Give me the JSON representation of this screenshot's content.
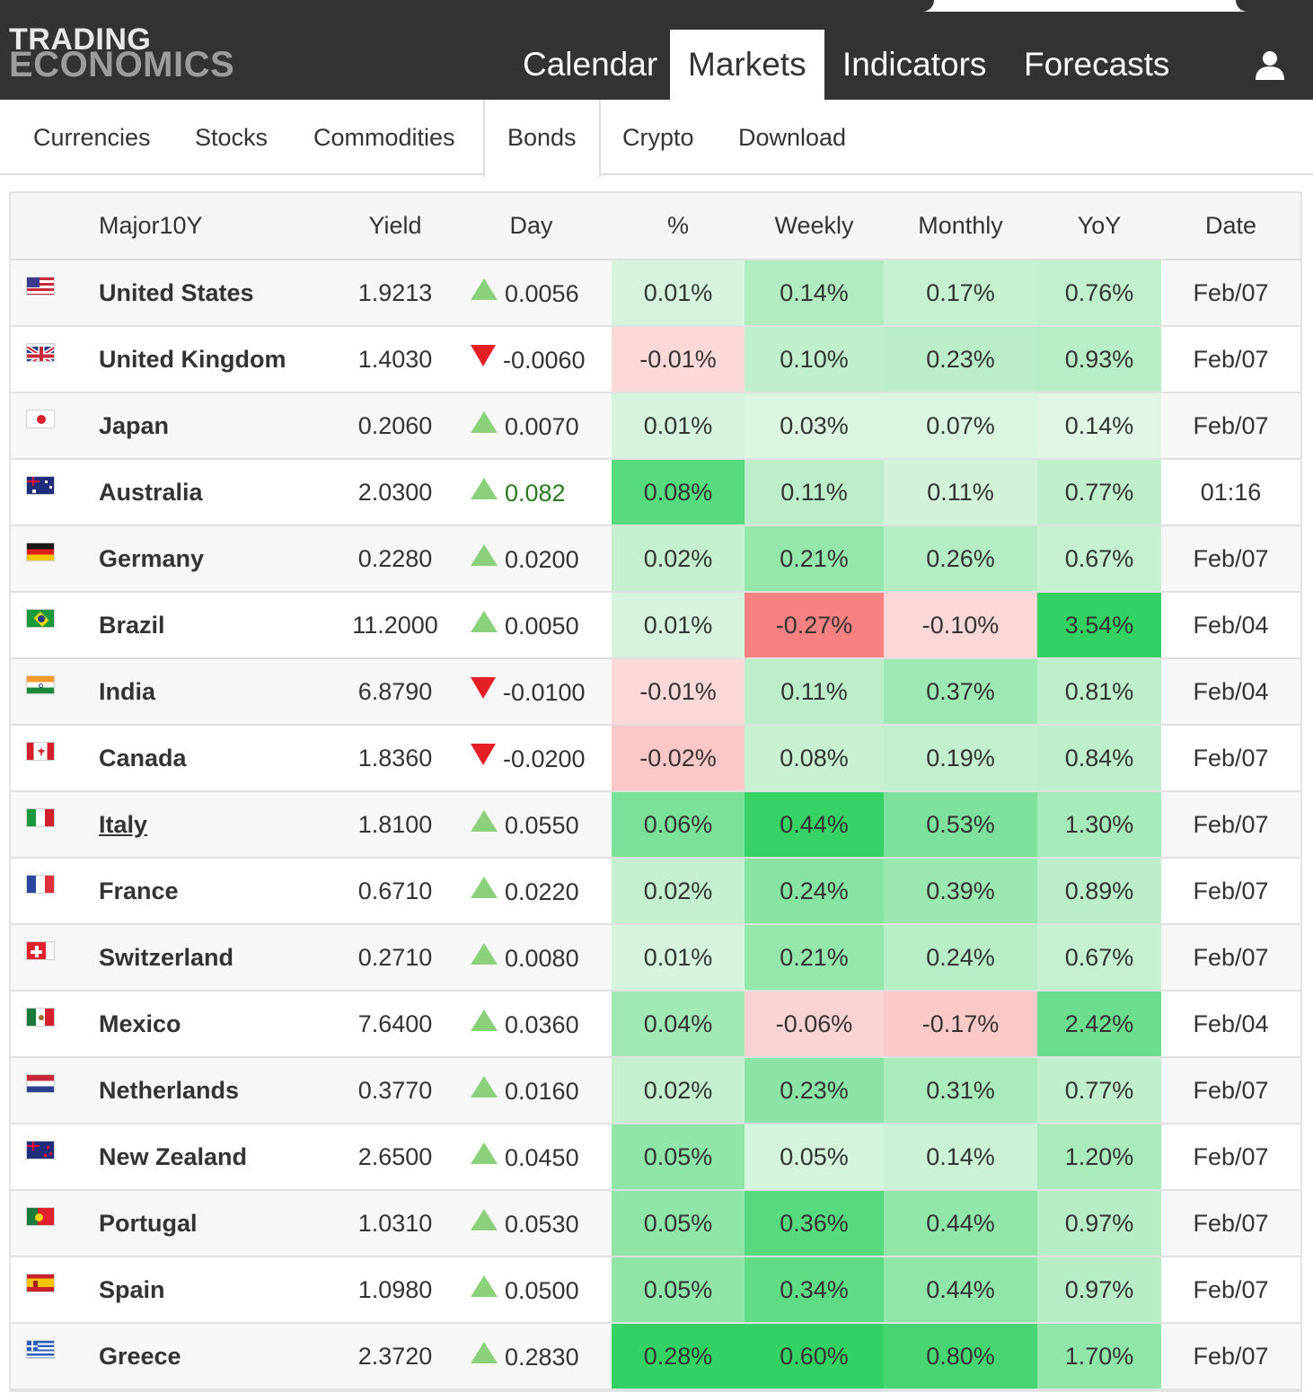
{
  "brand": {
    "line1": "TRADING",
    "line2": "ECONOMICS"
  },
  "main_nav": [
    {
      "label": "Calendar",
      "active": false
    },
    {
      "label": "Markets",
      "active": true
    },
    {
      "label": "Indicators",
      "active": false
    },
    {
      "label": "Forecasts",
      "active": false
    }
  ],
  "user_icon": "user-icon",
  "sub_nav": [
    {
      "label": "Currencies",
      "active": false
    },
    {
      "label": "Stocks",
      "active": false
    },
    {
      "label": "Commodities",
      "active": false
    },
    {
      "label": "Bonds",
      "active": true
    },
    {
      "label": "Crypto",
      "active": false
    },
    {
      "label": "Download",
      "active": false
    }
  ],
  "table": {
    "headers": [
      "Major10Y",
      "Yield",
      "Day",
      "%",
      "Weekly",
      "Monthly",
      "YoY",
      "Date"
    ],
    "rows": [
      {
        "flag": "us-flag-icon",
        "name": "United States",
        "yield": "1.9213",
        "day": "0.0056",
        "dir": "up",
        "pct": "0.01%",
        "weekly": "0.14%",
        "monthly": "0.17%",
        "yoy": "0.76%",
        "date": "Feb/07"
      },
      {
        "flag": "uk-flag-icon",
        "name": "United Kingdom",
        "yield": "1.4030",
        "day": "-0.0060",
        "dir": "down",
        "pct": "-0.01%",
        "weekly": "0.10%",
        "monthly": "0.23%",
        "yoy": "0.93%",
        "date": "Feb/07"
      },
      {
        "flag": "japan-flag-icon",
        "name": "Japan",
        "yield": "0.2060",
        "day": "0.0070",
        "dir": "up",
        "pct": "0.01%",
        "weekly": "0.03%",
        "monthly": "0.07%",
        "yoy": "0.14%",
        "date": "Feb/07"
      },
      {
        "flag": "australia-flag-icon",
        "name": "Australia",
        "yield": "2.0300",
        "day": "0.082",
        "dir": "up",
        "highlight_day": true,
        "pct": "0.08%",
        "weekly": "0.11%",
        "monthly": "0.11%",
        "yoy": "0.77%",
        "date": "01:16"
      },
      {
        "flag": "germany-flag-icon",
        "name": "Germany",
        "yield": "0.2280",
        "day": "0.0200",
        "dir": "up",
        "pct": "0.02%",
        "weekly": "0.21%",
        "monthly": "0.26%",
        "yoy": "0.67%",
        "date": "Feb/07"
      },
      {
        "flag": "brazil-flag-icon",
        "name": "Brazil",
        "yield": "11.2000",
        "day": "0.0050",
        "dir": "up",
        "pct": "0.01%",
        "weekly": "-0.27%",
        "monthly": "-0.10%",
        "yoy": "3.54%",
        "date": "Feb/04"
      },
      {
        "flag": "india-flag-icon",
        "name": "India",
        "yield": "6.8790",
        "day": "-0.0100",
        "dir": "down",
        "pct": "-0.01%",
        "weekly": "0.11%",
        "monthly": "0.37%",
        "yoy": "0.81%",
        "date": "Feb/04"
      },
      {
        "flag": "canada-flag-icon",
        "name": "Canada",
        "yield": "1.8360",
        "day": "-0.0200",
        "dir": "down",
        "pct": "-0.02%",
        "weekly": "0.08%",
        "monthly": "0.19%",
        "yoy": "0.84%",
        "date": "Feb/07"
      },
      {
        "flag": "italy-flag-icon",
        "name": "Italy",
        "link": true,
        "yield": "1.8100",
        "day": "0.0550",
        "dir": "up",
        "pct": "0.06%",
        "weekly": "0.44%",
        "monthly": "0.53%",
        "yoy": "1.30%",
        "date": "Feb/07"
      },
      {
        "flag": "france-flag-icon",
        "name": "France",
        "yield": "0.6710",
        "day": "0.0220",
        "dir": "up",
        "pct": "0.02%",
        "weekly": "0.24%",
        "monthly": "0.39%",
        "yoy": "0.89%",
        "date": "Feb/07"
      },
      {
        "flag": "switzerland-flag-icon",
        "name": "Switzerland",
        "yield": "0.2710",
        "day": "0.0080",
        "dir": "up",
        "pct": "0.01%",
        "weekly": "0.21%",
        "monthly": "0.24%",
        "yoy": "0.67%",
        "date": "Feb/07"
      },
      {
        "flag": "mexico-flag-icon",
        "name": "Mexico",
        "yield": "7.6400",
        "day": "0.0360",
        "dir": "up",
        "pct": "0.04%",
        "weekly": "-0.06%",
        "monthly": "-0.17%",
        "yoy": "2.42%",
        "date": "Feb/04"
      },
      {
        "flag": "netherlands-flag-icon",
        "name": "Netherlands",
        "yield": "0.3770",
        "day": "0.0160",
        "dir": "up",
        "pct": "0.02%",
        "weekly": "0.23%",
        "monthly": "0.31%",
        "yoy": "0.77%",
        "date": "Feb/07"
      },
      {
        "flag": "new-zealand-flag-icon",
        "name": "New Zealand",
        "yield": "2.6500",
        "day": "0.0450",
        "dir": "up",
        "pct": "0.05%",
        "weekly": "0.05%",
        "monthly": "0.14%",
        "yoy": "1.20%",
        "date": "Feb/07"
      },
      {
        "flag": "portugal-flag-icon",
        "name": "Portugal",
        "yield": "1.0310",
        "day": "0.0530",
        "dir": "up",
        "pct": "0.05%",
        "weekly": "0.36%",
        "monthly": "0.44%",
        "yoy": "0.97%",
        "date": "Feb/07"
      },
      {
        "flag": "spain-flag-icon",
        "name": "Spain",
        "yield": "1.0980",
        "day": "0.0500",
        "dir": "up",
        "pct": "0.05%",
        "weekly": "0.34%",
        "monthly": "0.44%",
        "yoy": "0.97%",
        "date": "Feb/07"
      },
      {
        "flag": "greece-flag-icon",
        "name": "Greece",
        "yield": "2.3720",
        "day": "0.2830",
        "dir": "up",
        "pct": "0.28%",
        "weekly": "0.60%",
        "monthly": "0.80%",
        "yoy": "1.70%",
        "date": "Feb/07"
      }
    ]
  },
  "colors": {
    "nav_bg": "#333333",
    "up_arrow": "#8bd17c",
    "down_arrow": "#e31e24",
    "heat_pos_strong": "#33d163",
    "heat_pos_light": "#e8f8ea",
    "heat_neg_strong": "#f73b3b",
    "heat_neg_light": "#fdeaea"
  }
}
